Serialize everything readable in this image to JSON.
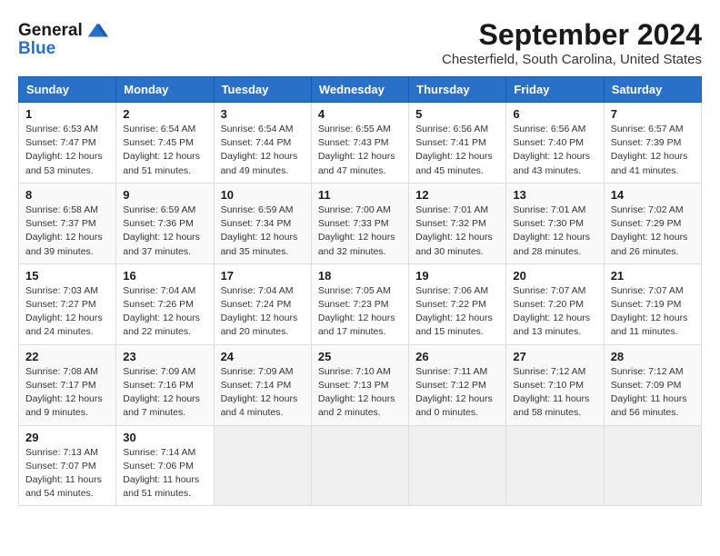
{
  "logo": {
    "text_general": "General",
    "text_blue": "Blue"
  },
  "title": {
    "month_year": "September 2024",
    "location": "Chesterfield, South Carolina, United States"
  },
  "weekdays": [
    "Sunday",
    "Monday",
    "Tuesday",
    "Wednesday",
    "Thursday",
    "Friday",
    "Saturday"
  ],
  "weeks": [
    [
      {
        "day": "1",
        "sunrise": "6:53 AM",
        "sunset": "7:47 PM",
        "daylight": "12 hours and 53 minutes."
      },
      {
        "day": "2",
        "sunrise": "6:54 AM",
        "sunset": "7:45 PM",
        "daylight": "12 hours and 51 minutes."
      },
      {
        "day": "3",
        "sunrise": "6:54 AM",
        "sunset": "7:44 PM",
        "daylight": "12 hours and 49 minutes."
      },
      {
        "day": "4",
        "sunrise": "6:55 AM",
        "sunset": "7:43 PM",
        "daylight": "12 hours and 47 minutes."
      },
      {
        "day": "5",
        "sunrise": "6:56 AM",
        "sunset": "7:41 PM",
        "daylight": "12 hours and 45 minutes."
      },
      {
        "day": "6",
        "sunrise": "6:56 AM",
        "sunset": "7:40 PM",
        "daylight": "12 hours and 43 minutes."
      },
      {
        "day": "7",
        "sunrise": "6:57 AM",
        "sunset": "7:39 PM",
        "daylight": "12 hours and 41 minutes."
      }
    ],
    [
      {
        "day": "8",
        "sunrise": "6:58 AM",
        "sunset": "7:37 PM",
        "daylight": "12 hours and 39 minutes."
      },
      {
        "day": "9",
        "sunrise": "6:59 AM",
        "sunset": "7:36 PM",
        "daylight": "12 hours and 37 minutes."
      },
      {
        "day": "10",
        "sunrise": "6:59 AM",
        "sunset": "7:34 PM",
        "daylight": "12 hours and 35 minutes."
      },
      {
        "day": "11",
        "sunrise": "7:00 AM",
        "sunset": "7:33 PM",
        "daylight": "12 hours and 32 minutes."
      },
      {
        "day": "12",
        "sunrise": "7:01 AM",
        "sunset": "7:32 PM",
        "daylight": "12 hours and 30 minutes."
      },
      {
        "day": "13",
        "sunrise": "7:01 AM",
        "sunset": "7:30 PM",
        "daylight": "12 hours and 28 minutes."
      },
      {
        "day": "14",
        "sunrise": "7:02 AM",
        "sunset": "7:29 PM",
        "daylight": "12 hours and 26 minutes."
      }
    ],
    [
      {
        "day": "15",
        "sunrise": "7:03 AM",
        "sunset": "7:27 PM",
        "daylight": "12 hours and 24 minutes."
      },
      {
        "day": "16",
        "sunrise": "7:04 AM",
        "sunset": "7:26 PM",
        "daylight": "12 hours and 22 minutes."
      },
      {
        "day": "17",
        "sunrise": "7:04 AM",
        "sunset": "7:24 PM",
        "daylight": "12 hours and 20 minutes."
      },
      {
        "day": "18",
        "sunrise": "7:05 AM",
        "sunset": "7:23 PM",
        "daylight": "12 hours and 17 minutes."
      },
      {
        "day": "19",
        "sunrise": "7:06 AM",
        "sunset": "7:22 PM",
        "daylight": "12 hours and 15 minutes."
      },
      {
        "day": "20",
        "sunrise": "7:07 AM",
        "sunset": "7:20 PM",
        "daylight": "12 hours and 13 minutes."
      },
      {
        "day": "21",
        "sunrise": "7:07 AM",
        "sunset": "7:19 PM",
        "daylight": "12 hours and 11 minutes."
      }
    ],
    [
      {
        "day": "22",
        "sunrise": "7:08 AM",
        "sunset": "7:17 PM",
        "daylight": "12 hours and 9 minutes."
      },
      {
        "day": "23",
        "sunrise": "7:09 AM",
        "sunset": "7:16 PM",
        "daylight": "12 hours and 7 minutes."
      },
      {
        "day": "24",
        "sunrise": "7:09 AM",
        "sunset": "7:14 PM",
        "daylight": "12 hours and 4 minutes."
      },
      {
        "day": "25",
        "sunrise": "7:10 AM",
        "sunset": "7:13 PM",
        "daylight": "12 hours and 2 minutes."
      },
      {
        "day": "26",
        "sunrise": "7:11 AM",
        "sunset": "7:12 PM",
        "daylight": "12 hours and 0 minutes."
      },
      {
        "day": "27",
        "sunrise": "7:12 AM",
        "sunset": "7:10 PM",
        "daylight": "11 hours and 58 minutes."
      },
      {
        "day": "28",
        "sunrise": "7:12 AM",
        "sunset": "7:09 PM",
        "daylight": "11 hours and 56 minutes."
      }
    ],
    [
      {
        "day": "29",
        "sunrise": "7:13 AM",
        "sunset": "7:07 PM",
        "daylight": "11 hours and 54 minutes."
      },
      {
        "day": "30",
        "sunrise": "7:14 AM",
        "sunset": "7:06 PM",
        "daylight": "11 hours and 51 minutes."
      },
      null,
      null,
      null,
      null,
      null
    ]
  ]
}
